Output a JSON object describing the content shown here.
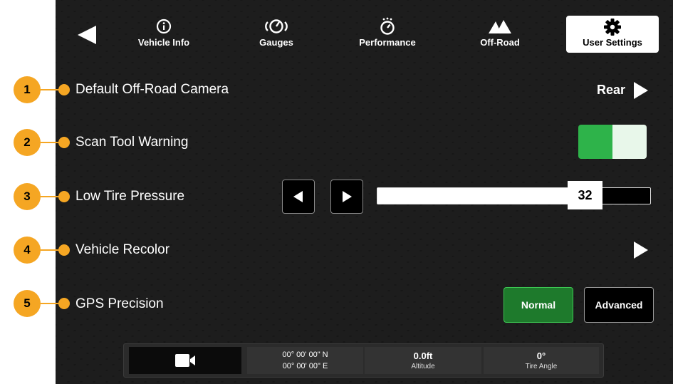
{
  "nav": {
    "back": {
      "icon": "back-arrow-icon"
    },
    "tabs": [
      {
        "label": "Vehicle Info",
        "icon": "info-icon",
        "active": false
      },
      {
        "label": "Gauges",
        "icon": "gauge-icon",
        "active": false
      },
      {
        "label": "Performance",
        "icon": "stopwatch-icon",
        "active": false
      },
      {
        "label": "Off-Road",
        "icon": "mountain-icon",
        "active": false
      },
      {
        "label": "User Settings",
        "icon": "gear-icon",
        "active": true
      }
    ]
  },
  "callouts": [
    "1",
    "2",
    "3",
    "4",
    "5"
  ],
  "settings": {
    "camera": {
      "label": "Default Off-Road Camera",
      "value": "Rear"
    },
    "scan_tool": {
      "label": "Scan Tool Warning",
      "enabled": true
    },
    "tire_pressure": {
      "label": "Low Tire Pressure",
      "value": "32",
      "fill_fraction": 0.73
    },
    "recolor": {
      "label": "Vehicle Recolor"
    },
    "gps": {
      "label": "GPS Precision",
      "options": [
        "Normal",
        "Advanced"
      ],
      "selected": "Normal"
    }
  },
  "status_bar": {
    "camera_icon": "video-camera-icon",
    "lat": "00° 00' 00\" N",
    "lon": "00° 00' 00\" E",
    "altitude_value": "0.0ft",
    "altitude_label": "Altitude",
    "tire_angle_value": "0°",
    "tire_angle_label": "Tire Angle"
  },
  "colors": {
    "callout": "#f5a623",
    "toggle_on": "#2eb34a",
    "normal_button": "#1e7a2c",
    "background": "#121212"
  }
}
